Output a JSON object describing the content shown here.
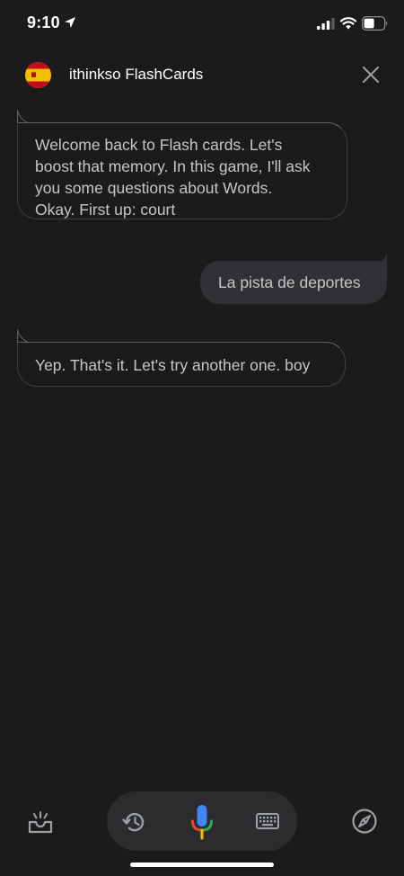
{
  "status_bar": {
    "time": "9:10",
    "icons": [
      "location-arrow-icon",
      "cellular-signal-icon",
      "wifi-icon",
      "battery-icon"
    ]
  },
  "header": {
    "title": "ithinkso FlashCards",
    "avatar": "spain-flag-icon",
    "close_icon": "close-icon"
  },
  "messages": [
    {
      "role": "assistant",
      "lines": [
        "Welcome back to Flash cards. Let's",
        "boost that memory. In this game, I'll ask",
        "you some questions about Words.",
        "Okay. First up: court"
      ]
    },
    {
      "role": "user",
      "text": "La pista de deportes"
    },
    {
      "role": "assistant",
      "text": "Yep. That's it. Let's try another one. boy"
    }
  ],
  "bottom_bar": {
    "icons": [
      "tray-icon",
      "history-icon",
      "mic-icon",
      "keyboard-icon",
      "compass-icon"
    ]
  },
  "colors": {
    "background": "#1b1b1b",
    "bubble_border": "#3c4043",
    "user_bubble": "#303134",
    "text": "#c4c7c5",
    "mic_blue": "#4285f4",
    "mic_red": "#ea4335",
    "mic_yellow": "#fbbc04",
    "mic_green": "#34a853"
  }
}
